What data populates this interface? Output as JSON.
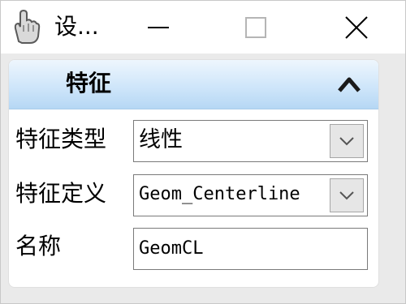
{
  "window": {
    "title": "设..."
  },
  "panel": {
    "title": "特征"
  },
  "fields": {
    "feature_type": {
      "label": "特征类型",
      "value": "线性"
    },
    "feature_definition": {
      "label": "特征定义",
      "value": "Geom_Centerline"
    },
    "name": {
      "label": "名称",
      "value": "GeomCL"
    }
  },
  "icons": {
    "app": "hand-icon",
    "minimize": "minimize-icon",
    "maximize": "maximize-icon",
    "close": "close-icon",
    "collapse": "chevron-up-icon",
    "dropdown": "chevron-down-icon"
  },
  "colors": {
    "panel_header_top": "#eef6fd",
    "panel_header_bottom": "#b6d7f4",
    "window_bg": "#eaeaea"
  }
}
